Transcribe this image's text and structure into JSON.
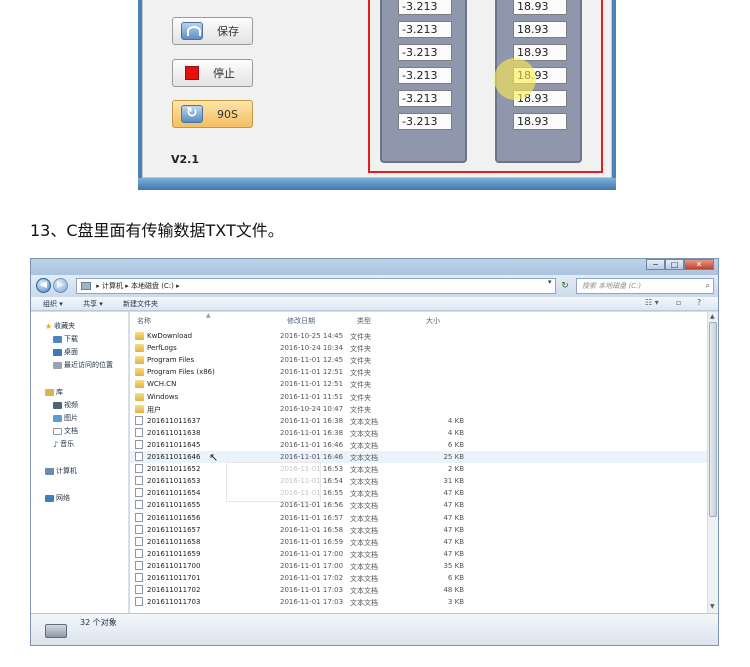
{
  "app": {
    "buttons": {
      "save": "保存",
      "stop": "停止",
      "timer": "90S"
    },
    "version": "V2.1",
    "left_values": [
      "-3.213",
      "-3.213",
      "-3.213",
      "-3.213",
      "-3.213",
      "-3.213"
    ],
    "right_values": [
      "18.93",
      "18.93",
      "18.93",
      "18.93",
      "18.93",
      "18.93"
    ]
  },
  "caption": "13、C盘里面有传输数据TXT文件。",
  "explorer": {
    "address": {
      "computer": "计算机",
      "drive": "本地磁盘 (C:)",
      "separator": "▸"
    },
    "search_placeholder": "搜索 本地磁盘 (C:)",
    "toolbar": {
      "organize": "组织 ▾",
      "share": "共享 ▾",
      "new_folder": "新建文件夹"
    },
    "window_buttons": {
      "min": "−",
      "max": "□",
      "close": "✕"
    },
    "nav": {
      "favorites": "收藏夹",
      "downloads": "下载",
      "desktop": "桌面",
      "recent": "最近访问的位置",
      "libraries": "库",
      "videos": "视频",
      "pictures": "图片",
      "documents": "文档",
      "music": "音乐",
      "computer": "计算机",
      "network": "网络"
    },
    "columns": {
      "name": "名称",
      "date": "修改日期",
      "type": "类型",
      "size": "大小"
    },
    "files": [
      {
        "name": "KwDownload",
        "date": "2016-10-25 14:45",
        "type": "文件夹",
        "size": "",
        "kind": "folder"
      },
      {
        "name": "PerfLogs",
        "date": "2016-10-24 10:34",
        "type": "文件夹",
        "size": "",
        "kind": "folder"
      },
      {
        "name": "Program Files",
        "date": "2016-11-01 12:45",
        "type": "文件夹",
        "size": "",
        "kind": "folder"
      },
      {
        "name": "Program Files (x86)",
        "date": "2016-11-01 12:51",
        "type": "文件夹",
        "size": "",
        "kind": "folder"
      },
      {
        "name": "WCH.CN",
        "date": "2016-11-01 12:51",
        "type": "文件夹",
        "size": "",
        "kind": "folder"
      },
      {
        "name": "Windows",
        "date": "2016-11-01 11:51",
        "type": "文件夹",
        "size": "",
        "kind": "folder"
      },
      {
        "name": "用户",
        "date": "2016-10-24 10:47",
        "type": "文件夹",
        "size": "",
        "kind": "folder"
      },
      {
        "name": "201611011637",
        "date": "2016-11-01 16:38",
        "type": "文本文档",
        "size": "4 KB",
        "kind": "txt"
      },
      {
        "name": "201611011638",
        "date": "2016-11-01 16:38",
        "type": "文本文档",
        "size": "4 KB",
        "kind": "txt"
      },
      {
        "name": "201611011645",
        "date": "2016-11-01 16:46",
        "type": "文本文档",
        "size": "6 KB",
        "kind": "txt"
      },
      {
        "name": "201611011646",
        "date": "2016-11-01 16:46",
        "type": "文本文档",
        "size": "25 KB",
        "kind": "txt"
      },
      {
        "name": "201611011652",
        "date": "2016-11-01 16:53",
        "type": "文本文档",
        "size": "2 KB",
        "kind": "txt"
      },
      {
        "name": "201611011653",
        "date": "2016-11-01 16:54",
        "type": "文本文档",
        "size": "31 KB",
        "kind": "txt"
      },
      {
        "name": "201611011654",
        "date": "2016-11-01 16:55",
        "type": "文本文档",
        "size": "47 KB",
        "kind": "txt"
      },
      {
        "name": "201611011655",
        "date": "2016-11-01 16:56",
        "type": "文本文档",
        "size": "47 KB",
        "kind": "txt"
      },
      {
        "name": "201611011656",
        "date": "2016-11-01 16:57",
        "type": "文本文档",
        "size": "47 KB",
        "kind": "txt"
      },
      {
        "name": "201611011657",
        "date": "2016-11-01 16:58",
        "type": "文本文档",
        "size": "47 KB",
        "kind": "txt"
      },
      {
        "name": "201611011658",
        "date": "2016-11-01 16:59",
        "type": "文本文档",
        "size": "47 KB",
        "kind": "txt"
      },
      {
        "name": "201611011659",
        "date": "2016-11-01 17:00",
        "type": "文本文档",
        "size": "47 KB",
        "kind": "txt"
      },
      {
        "name": "201611011700",
        "date": "2016-11-01 17:00",
        "type": "文本文档",
        "size": "35 KB",
        "kind": "txt"
      },
      {
        "name": "201611011701",
        "date": "2016-11-01 17:02",
        "type": "文本文档",
        "size": "6 KB",
        "kind": "txt"
      },
      {
        "name": "201611011702",
        "date": "2016-11-01 17:03",
        "type": "文本文档",
        "size": "48 KB",
        "kind": "txt"
      },
      {
        "name": "201611011703",
        "date": "2016-11-01 17:03",
        "type": "文本文档",
        "size": "3 KB",
        "kind": "txt"
      }
    ],
    "status_count": "32 个对象"
  }
}
